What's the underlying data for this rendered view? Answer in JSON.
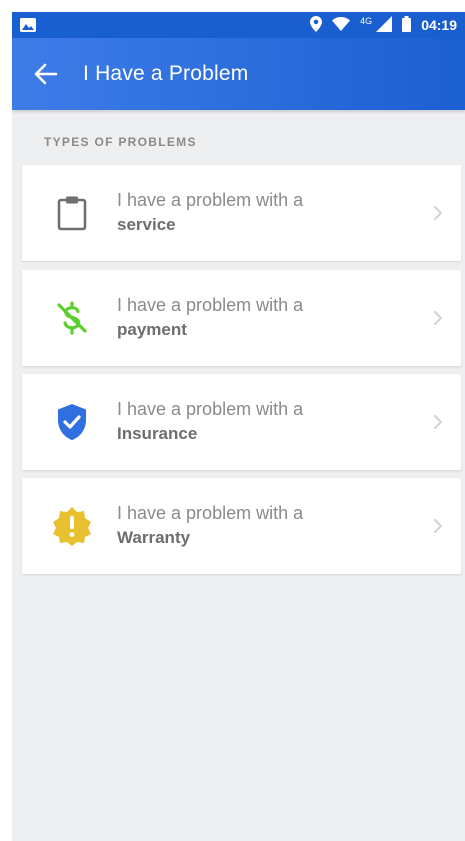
{
  "status_bar": {
    "network_label": "4G",
    "time": "04:19"
  },
  "app_bar": {
    "title": "I Have a Problem"
  },
  "section": {
    "label": "TYPES OF PROBLEMS"
  },
  "problems": [
    {
      "line1": "I have a problem with a",
      "line2": "service",
      "icon": "clipboard-icon",
      "color": "#6f6f6f"
    },
    {
      "line1": "I have a problem with a",
      "line2": "payment",
      "icon": "money-off-icon",
      "color": "#5ccf2e"
    },
    {
      "line1": "I have a problem with a",
      "line2": "Insurance",
      "icon": "shield-check-icon",
      "color": "#2f6fe0"
    },
    {
      "line1": "I have a problem with a",
      "line2": "Warranty",
      "icon": "warning-badge-icon",
      "color": "#e8c130"
    }
  ]
}
